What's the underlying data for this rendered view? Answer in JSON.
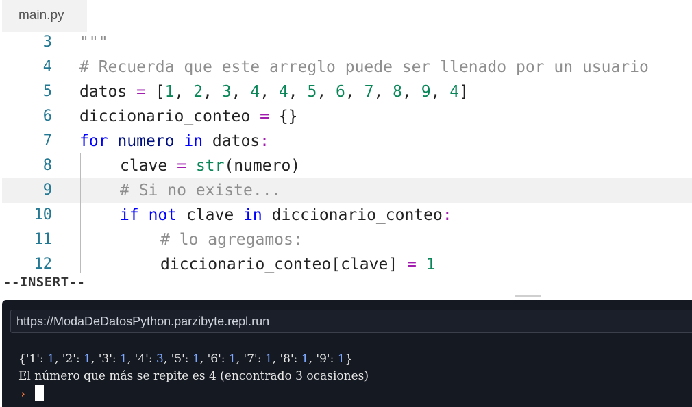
{
  "tab": {
    "filename": "main.py"
  },
  "editor": {
    "lines": [
      {
        "num": "3",
        "tokens": [
          [
            "cm",
            "\"\"\""
          ]
        ]
      },
      {
        "num": "4",
        "tokens": [
          [
            "cm",
            "# Recuerda que este arreglo puede ser llenado por un usuario"
          ]
        ]
      },
      {
        "num": "5",
        "tokens": [
          [
            "tx",
            "datos "
          ],
          [
            "op",
            "="
          ],
          [
            "tx",
            " ["
          ],
          [
            "nm",
            "1"
          ],
          [
            "tx",
            ", "
          ],
          [
            "nm",
            "2"
          ],
          [
            "tx",
            ", "
          ],
          [
            "nm",
            "3"
          ],
          [
            "tx",
            ", "
          ],
          [
            "nm",
            "4"
          ],
          [
            "tx",
            ", "
          ],
          [
            "nm",
            "4"
          ],
          [
            "tx",
            ", "
          ],
          [
            "nm",
            "5"
          ],
          [
            "tx",
            ", "
          ],
          [
            "nm",
            "6"
          ],
          [
            "tx",
            ", "
          ],
          [
            "nm",
            "7"
          ],
          [
            "tx",
            ", "
          ],
          [
            "nm",
            "8"
          ],
          [
            "tx",
            ", "
          ],
          [
            "nm",
            "9"
          ],
          [
            "tx",
            ", "
          ],
          [
            "nm",
            "4"
          ],
          [
            "tx",
            "]"
          ]
        ]
      },
      {
        "num": "6",
        "tokens": [
          [
            "tx",
            "diccionario_conteo "
          ],
          [
            "op",
            "="
          ],
          [
            "tx",
            " {}"
          ]
        ]
      },
      {
        "num": "7",
        "tokens": [
          [
            "kw",
            "for"
          ],
          [
            "tx",
            " "
          ],
          [
            "id",
            "numero"
          ],
          [
            "tx",
            " "
          ],
          [
            "kw",
            "in"
          ],
          [
            "tx",
            " datos"
          ],
          [
            "op",
            ":"
          ]
        ]
      },
      {
        "num": "8",
        "indent": 1,
        "tokens": [
          [
            "tx",
            "clave "
          ],
          [
            "op",
            "="
          ],
          [
            "tx",
            " "
          ],
          [
            "bi",
            "str"
          ],
          [
            "tx",
            "(numero)"
          ]
        ]
      },
      {
        "num": "9",
        "indent": 1,
        "active": true,
        "tokens": [
          [
            "cm",
            "# Si no existe..."
          ]
        ]
      },
      {
        "num": "10",
        "indent": 1,
        "tokens": [
          [
            "kw",
            "if"
          ],
          [
            "tx",
            " "
          ],
          [
            "kw",
            "not"
          ],
          [
            "tx",
            " clave "
          ],
          [
            "kw",
            "in"
          ],
          [
            "tx",
            " diccionario_conteo"
          ],
          [
            "op",
            ":"
          ]
        ]
      },
      {
        "num": "11",
        "indent": 2,
        "tokens": [
          [
            "cm",
            "# lo agregamos:"
          ]
        ]
      },
      {
        "num": "12",
        "indent": 2,
        "tokens": [
          [
            "tx",
            "diccionario_conteo[clave] "
          ],
          [
            "op",
            "="
          ],
          [
            "tx",
            " "
          ],
          [
            "nm",
            "1"
          ]
        ]
      }
    ]
  },
  "status": {
    "mode": "--INSERT--"
  },
  "console": {
    "url": "https://ModaDeDatosPython.parzibyte.repl.run",
    "output_lines": [
      "{'1': 1, '2': 1, '3': 1, '4': 3, '5': 1, '6': 1, '7': 1, '8': 1, '9': 1}",
      "El número que más se repite es 4 (encontrado 3 ocasiones)"
    ],
    "prompt_icon": "prompt-chevron-icon",
    "prompt_symbol": "›"
  },
  "colors": {
    "keyword": "#0000ff",
    "number": "#098658",
    "comment": "#8e8e8e",
    "operator": "#a31cb0",
    "line_number": "#237893",
    "console_bg": "#151922",
    "prompt": "#ff7d3b"
  }
}
